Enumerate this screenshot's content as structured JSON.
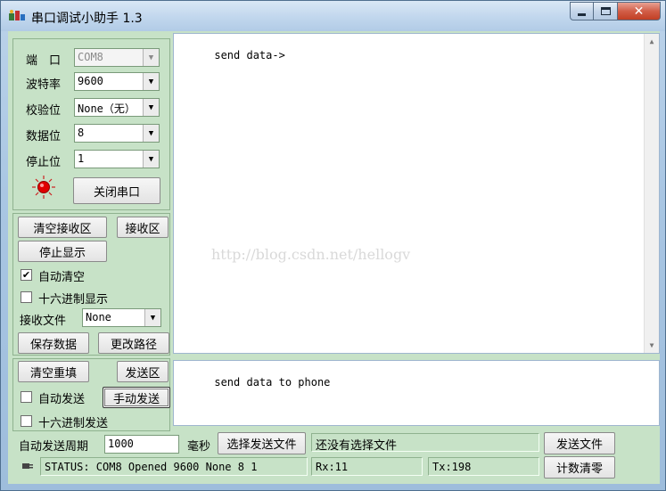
{
  "window": {
    "title": "串口调试小助手 1.3",
    "controls": {
      "minimize": "▭",
      "maximize": "□",
      "close": "✕"
    }
  },
  "port_settings": {
    "port_label": "端　口",
    "port_value": "COM8",
    "baud_label": "波特率",
    "baud_value": "9600",
    "parity_label": "校验位",
    "parity_value": "None（无）",
    "databits_label": "数据位",
    "databits_value": "8",
    "stopbits_label": "停止位",
    "stopbits_value": "1",
    "close_port_button": "关闭串口",
    "led_color": "#e00000"
  },
  "receive_panel": {
    "clear_receive_button": "清空接收区",
    "receive_area_button": "接收区",
    "stop_display_button": "停止显示",
    "auto_clear_label": "自动清空",
    "auto_clear_checked": true,
    "hex_display_label": "十六进制显示",
    "hex_display_checked": false,
    "receive_file_label": "接收文件",
    "receive_file_value": "None",
    "save_data_button": "保存数据",
    "change_path_button": "更改路径"
  },
  "send_panel": {
    "clear_resend_button": "清空重填",
    "send_area_button": "发送区",
    "auto_send_label": "自动发送",
    "auto_send_checked": false,
    "manual_send_button": "手动发送",
    "hex_send_label": "十六进制发送",
    "hex_send_checked": false
  },
  "receive_text": "send data->",
  "watermark": "http://blog.csdn.net/hellogv",
  "send_text": "send data to phone",
  "bottom": {
    "auto_period_label": "自动发送周期",
    "auto_period_value": "1000",
    "ms_label": "毫秒",
    "choose_file_button": "选择发送文件",
    "file_status": "还没有选择文件",
    "send_file_button": "发送文件",
    "status_text": "STATUS: COM8 Opened 9600 None  8 1",
    "rx_text": "Rx:11",
    "tx_text": "Tx:198",
    "clear_count_button": "计数清零"
  },
  "colors": {
    "panel_bg": "#c7e2c7",
    "title_bg": "#c3d8ee",
    "close_bg": "#c13f24"
  }
}
